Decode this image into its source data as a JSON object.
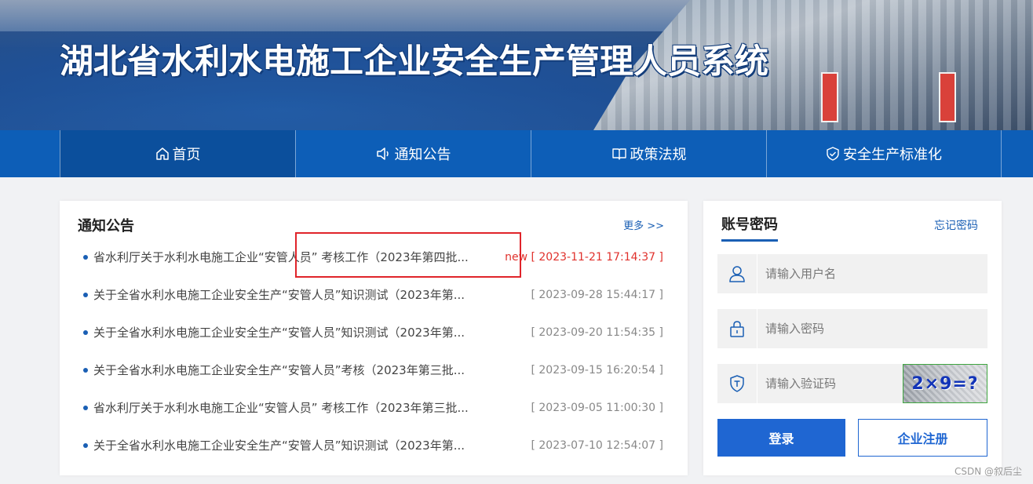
{
  "header": {
    "title": "湖北省水利水电施工企业安全生产管理人员系统"
  },
  "nav": {
    "items": [
      {
        "label": "首页",
        "icon": "home-icon"
      },
      {
        "label": "通知公告",
        "icon": "speaker-icon"
      },
      {
        "label": "政策法规",
        "icon": "book-icon"
      },
      {
        "label": "安全生产标准化",
        "icon": "shield-check-icon"
      }
    ]
  },
  "notice": {
    "title": "通知公告",
    "more": "更多 >>",
    "items": [
      {
        "text": "省水利厅关于水利水电施工企业“安管人员” 考核工作（2023年第四批...",
        "date": "new [ 2023-11-21 17:14:37 ]"
      },
      {
        "text": "关于全省水利水电施工企业安全生产“安管人员”知识测试（2023年第...",
        "date": "[ 2023-09-28 15:44:17 ]"
      },
      {
        "text": "关于全省水利水电施工企业安全生产“安管人员”知识测试（2023年第...",
        "date": "[ 2023-09-20 11:54:35 ]"
      },
      {
        "text": "关于全省水利水电施工企业安全生产“安管人员”考核（2023年第三批...",
        "date": "[ 2023-09-15 16:20:54 ]"
      },
      {
        "text": "省水利厅关于水利水电施工企业“安管人员” 考核工作（2023年第三批...",
        "date": "[ 2023-09-05 11:00:30 ]"
      },
      {
        "text": "关于全省水利水电施工企业安全生产“安管人员”知识测试（2023年第...",
        "date": "[ 2023-07-10 12:54:07 ]"
      }
    ]
  },
  "login": {
    "tab": "账号密码",
    "forgot": "忘记密码",
    "username_placeholder": "请输入用户名",
    "password_placeholder": "请输入密码",
    "captcha_placeholder": "请输入验证码",
    "captcha_text": "2×9=?",
    "login_button": "登录",
    "register_button": "企业注册"
  },
  "watermark": "CSDN @叙后尘",
  "colors": {
    "nav_bg": "#0d5eb7",
    "accent": "#1f66d2",
    "new_date": "#e0312c",
    "highlight_box": "#e0242a"
  }
}
